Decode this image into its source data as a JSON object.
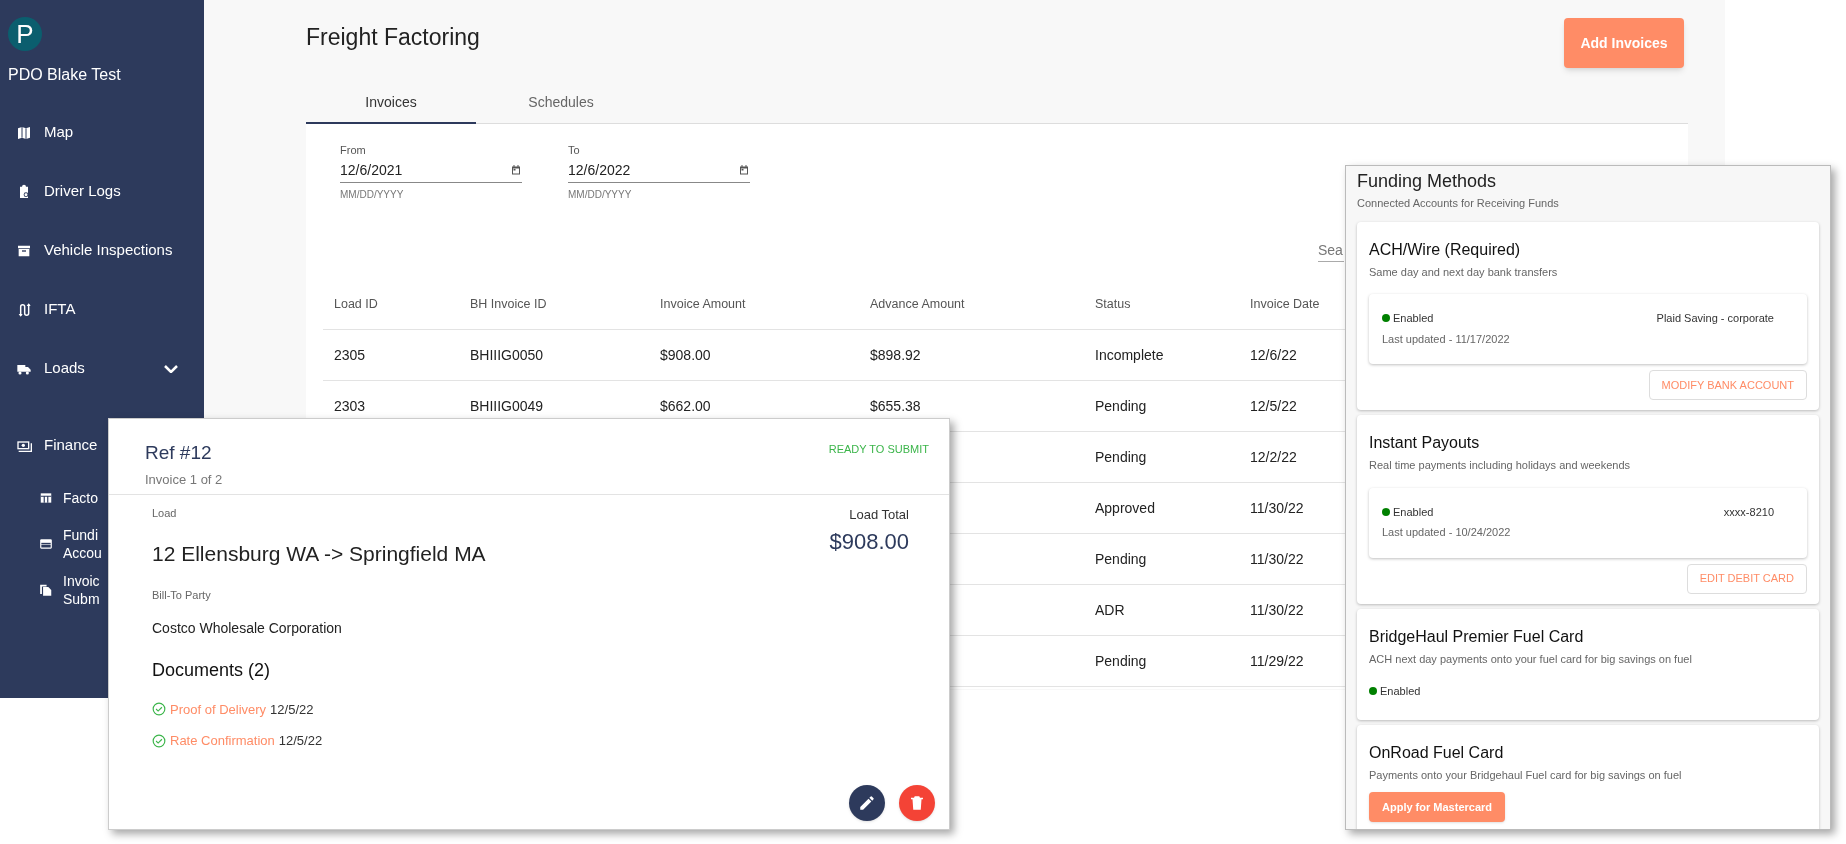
{
  "sidebar": {
    "avatar": "P",
    "account": "PDO Blake Test",
    "items": [
      {
        "label": "Map"
      },
      {
        "label": "Driver Logs"
      },
      {
        "label": "Vehicle Inspections"
      },
      {
        "label": "IFTA"
      },
      {
        "label": "Loads",
        "expanded": false
      },
      {
        "label": "Finance",
        "children": [
          {
            "label": "Facto"
          },
          {
            "label": "Fundi Accou"
          },
          {
            "label": "Invoic Subm"
          }
        ]
      }
    ]
  },
  "page": {
    "title": "Freight Factoring",
    "add_button": "Add Invoices",
    "tabs": [
      {
        "label": "Invoices",
        "selected": true
      },
      {
        "label": "Schedules",
        "selected": false
      }
    ],
    "date_fields": [
      {
        "label": "From",
        "value": "12/6/2021",
        "helper": "MM/DD/YYYY"
      },
      {
        "label": "To",
        "value": "12/6/2022",
        "helper": "MM/DD/YYYY"
      }
    ],
    "search": {
      "placeholder": "Sea"
    },
    "table": {
      "columns": [
        "Load ID",
        "BH Invoice ID",
        "Invoice Amount",
        "Advance Amount",
        "Status",
        "Invoice Date"
      ],
      "rows": [
        {
          "load_id": "2305",
          "bh_invoice_id": "BHIIIG0050",
          "invoice_amount": "$908.00",
          "advance_amount": "$898.92",
          "status": "Incomplete",
          "invoice_date": "12/6/22"
        },
        {
          "load_id": "2303",
          "bh_invoice_id": "BHIIIG0049",
          "invoice_amount": "$662.00",
          "advance_amount": "$655.38",
          "status": "Pending",
          "invoice_date": "12/5/22"
        },
        {
          "status": "Pending",
          "invoice_date": "12/2/22"
        },
        {
          "status": "Approved",
          "invoice_date": "11/30/22"
        },
        {
          "status": "Pending",
          "invoice_date": "11/30/22"
        },
        {
          "status": "ADR",
          "invoice_date": "11/30/22"
        },
        {
          "status": "Pending",
          "invoice_date": "11/29/22"
        }
      ]
    }
  },
  "invoice_card": {
    "title": "Ref #12",
    "subtitle": "Invoice 1 of 2",
    "status": "READY TO SUBMIT",
    "load_label": "Load",
    "load": "12 Ellensburg WA -> Springfield MA",
    "total_label": "Load Total",
    "total": "$908.00",
    "bill_to_label": "Bill-To Party",
    "bill_to": "Costco Wholesale Corporation",
    "documents_title": "Documents (2)",
    "documents": [
      {
        "name": "Proof of Delivery",
        "date": "12/5/22"
      },
      {
        "name": "Rate Confirmation",
        "date": "12/5/22"
      }
    ]
  },
  "funding_methods": {
    "title": "Funding Methods",
    "subtitle": "Connected Accounts for Receiving Funds",
    "methods": [
      {
        "kind": "account",
        "title": "ACH/Wire (Required)",
        "description": "Same day and next day bank transfers",
        "status": "Enabled",
        "enabled": true,
        "updated": "Last updated - 11/17/2022",
        "account": "Plaid Saving - corporate",
        "button": "MODIFY BANK ACCOUNT"
      },
      {
        "kind": "account",
        "title": "Instant Payouts",
        "description": "Real time payments including holidays and weekends",
        "status": "Enabled",
        "enabled": true,
        "updated": "Last updated - 10/24/2022",
        "account": "xxxx-8210",
        "button": "EDIT DEBIT CARD"
      },
      {
        "kind": "status",
        "title": "BridgeHaul Premier Fuel Card",
        "description": "ACH next day payments onto your fuel card for big savings on fuel",
        "status": "Enabled",
        "enabled": true
      },
      {
        "kind": "apply",
        "title": "OnRoad Fuel Card",
        "description": "Payments onto your Bridgehaul Fuel card for big savings on fuel",
        "button": "Apply for Mastercard"
      }
    ]
  }
}
